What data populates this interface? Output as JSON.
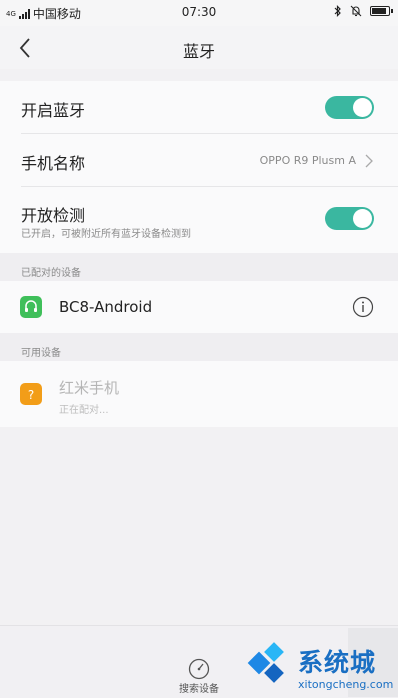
{
  "status_bar": {
    "network": "4G",
    "carrier": "中国移动",
    "time": "07:30",
    "battery_level": 0.9,
    "icons": [
      "signal-icon",
      "bluetooth-icon",
      "alarm-off-icon",
      "battery-icon"
    ]
  },
  "header": {
    "title": "蓝牙",
    "back_icon": "chevron-left-icon"
  },
  "settings": {
    "bluetooth_toggle": {
      "label": "开启蓝牙",
      "on": true
    },
    "device_name": {
      "label": "手机名称",
      "value": "OPPO R9 Plusm A"
    },
    "visibility_toggle": {
      "label": "开放检测",
      "sublabel": "已开启，可被附近所有蓝牙设备检测到",
      "on": true
    }
  },
  "paired_section": {
    "title": "已配对的设备",
    "devices": [
      {
        "name": "BC8-Android",
        "icon": "headset-icon",
        "icon_color": "#3fbf5a"
      }
    ]
  },
  "available_section": {
    "title": "可用设备",
    "devices": [
      {
        "name": "红米手机",
        "status": "正在配对...",
        "icon": "unknown-device-icon",
        "icon_color": "#f29300"
      }
    ]
  },
  "bottom": {
    "search_label": "搜索设备"
  },
  "watermark": {
    "title": "系统城",
    "url": "xitongcheng.com"
  },
  "colors": {
    "toggle_on": "#3ab7a0",
    "background": "#f2f1f3",
    "watermark_blue": "#1a6fc3"
  }
}
